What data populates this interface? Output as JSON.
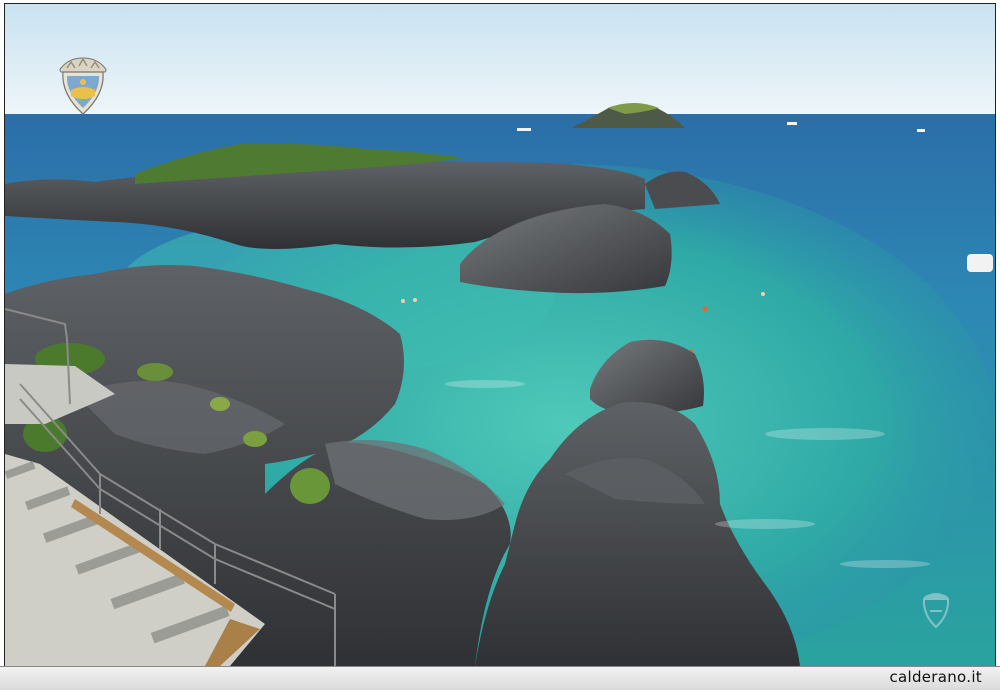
{
  "caption": {
    "site": "calderano.it"
  },
  "logo": {
    "icon": "town-crest-icon"
  },
  "watermark": {
    "icon": "crest-watermark-icon"
  },
  "colors": {
    "sky_top": "#cfe6f3",
    "sky_bottom": "#eaf4f8",
    "sea_deep": "#2a6fa8",
    "sea_mid": "#2f8fb3",
    "sea_shallow": "#3fb7ae",
    "rock_dark": "#3a3c3f",
    "rock_light": "#6b6e72",
    "vegetation": "#4f7a32",
    "step": "#d8d8d2",
    "wood": "#b08850"
  }
}
